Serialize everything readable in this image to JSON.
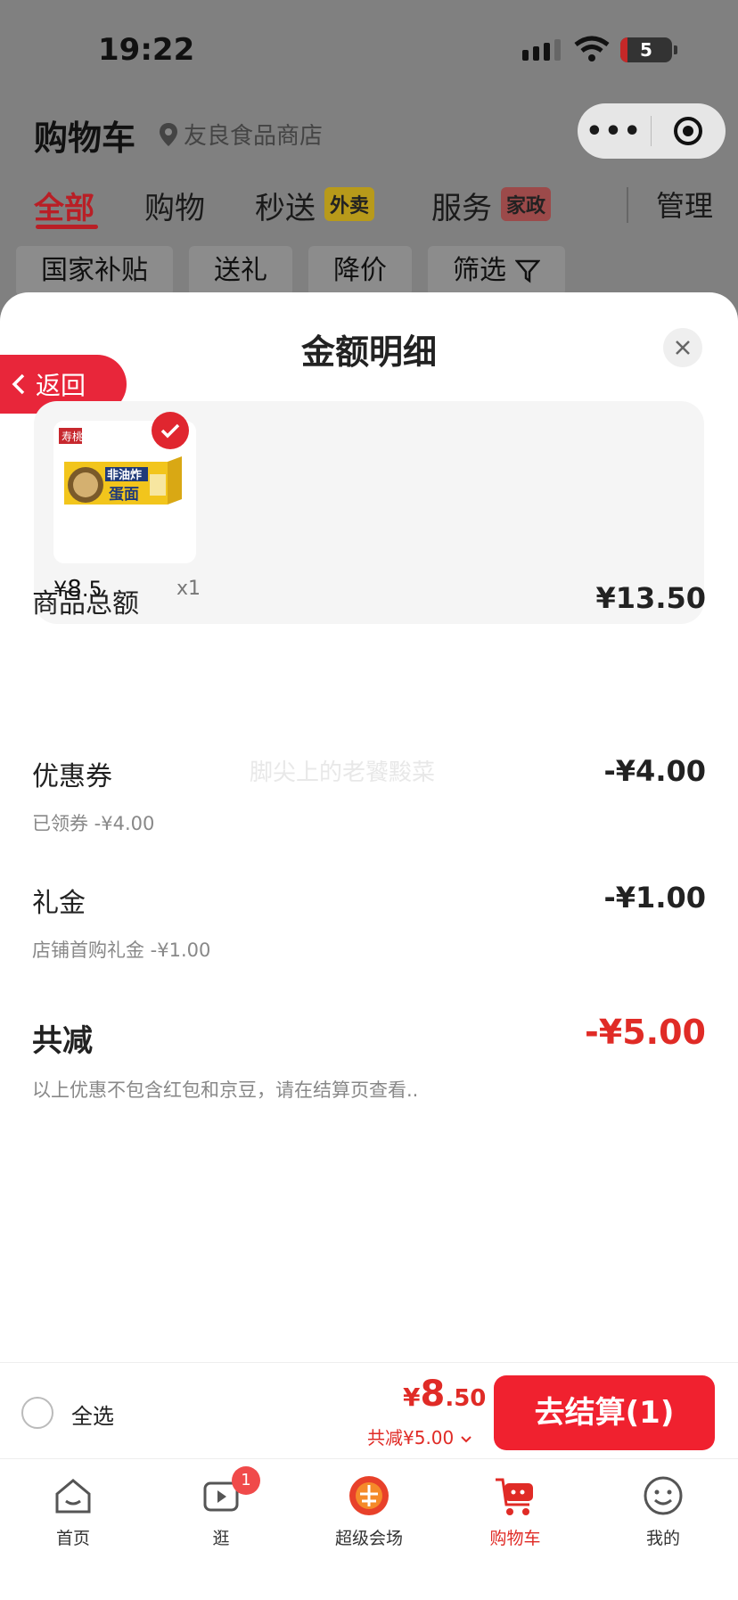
{
  "status": {
    "time": "19:22",
    "battery": "5"
  },
  "header": {
    "title": "购物车",
    "store": "友良食品商店"
  },
  "tabs": {
    "all": "全部",
    "shopping": "购物",
    "express": "秒送",
    "express_tag": "外卖",
    "service": "服务",
    "service_tag": "家政",
    "manage": "管理"
  },
  "filters": [
    "国家补贴",
    "送礼",
    "降价",
    "筛选"
  ],
  "sheet": {
    "title": "金额明细",
    "back": "返回",
    "product": {
      "price_sym": "¥",
      "price_int": "8",
      "price_dec": ".5",
      "qty": "x1",
      "brand": "寿桃",
      "label1": "非油炸",
      "label2": "蛋面"
    },
    "rows": {
      "subtotal_label": "商品总额",
      "subtotal_amount": "¥13.50",
      "coupon_label": "优惠券",
      "coupon_amount": "-¥4.00",
      "coupon_sub": "已领券 -¥4.00",
      "gift_label": "礼金",
      "gift_amount": "-¥1.00",
      "gift_sub": "店铺首购礼金 -¥1.00",
      "total_label": "共减",
      "total_amount": "-¥5.00",
      "total_note": "以上优惠不包含红包和京豆，请在结算页查看.."
    },
    "watermark": "脚尖上的老饕黢菜"
  },
  "bottombar": {
    "select_all": "全选",
    "price_sym": "¥",
    "price_int": "8",
    "price_dec": ".50",
    "saved": "共减¥5.00",
    "checkout": "去结算(1)"
  },
  "nav": {
    "home": "首页",
    "browse": "逛",
    "browse_badge": "1",
    "super": "超级会场",
    "cart": "购物车",
    "mine": "我的"
  },
  "colors": {
    "accent": "#e02b26",
    "checkout": "#f0212f"
  }
}
